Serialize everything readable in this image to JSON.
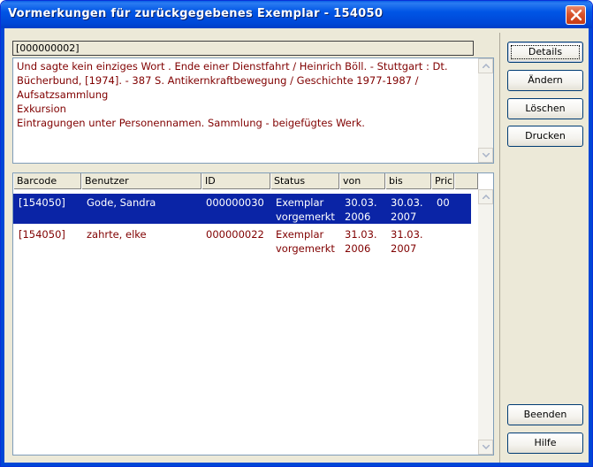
{
  "window": {
    "title": "Vormerkungen für zurückgegebenes Exemplar - 154050"
  },
  "record": {
    "id_field": "[000000002]",
    "description_lines": [
      "Und sagte kein einziges Wort . Ende einer Dienstfahrt / Heinrich Böll. - Stuttgart  : Dt.",
      "Bücherbund, [1974]. - 387 S. Antikernkraftbewegung / Geschichte 1977-1987 /",
      "Aufsatzsammlung",
      "Exkursion",
      "Eintragungen unter Personennamen. Sammlung - beigefügtes Werk."
    ]
  },
  "table": {
    "columns": [
      "Barcode",
      "Benutzer",
      "ID",
      "Status",
      "von",
      "bis",
      "Pric"
    ],
    "rows": [
      {
        "barcode": "[154050]",
        "benutzer": "Gode, Sandra",
        "id": "000000030",
        "status_1": "Exemplar",
        "status_2": "vorgemerkt",
        "von_1": "30.03.",
        "von_2": "2006",
        "bis_1": "30.03.",
        "bis_2": "2007",
        "pric": "00",
        "selected": true
      },
      {
        "barcode": "[154050]",
        "benutzer": "zahrte, elke",
        "id": "000000022",
        "status_1": "Exemplar",
        "status_2": "vorgemerkt",
        "von_1": "31.03.",
        "von_2": "2006",
        "bis_1": "31.03.",
        "bis_2": "2007",
        "pric": "",
        "selected": false
      }
    ]
  },
  "buttons": {
    "details": "Details",
    "aendern": "Ändern",
    "loeschen": "Löschen",
    "drucken": "Drucken",
    "beenden": "Beenden",
    "hilfe": "Hilfe"
  },
  "colors": {
    "title_bar": "#0055e5",
    "selection": "#0a24a6",
    "text_red": "#800000"
  },
  "icons": {
    "close": "close-icon",
    "scroll_up": "scroll-up-arrow-icon",
    "scroll_down": "scroll-down-arrow-icon"
  }
}
